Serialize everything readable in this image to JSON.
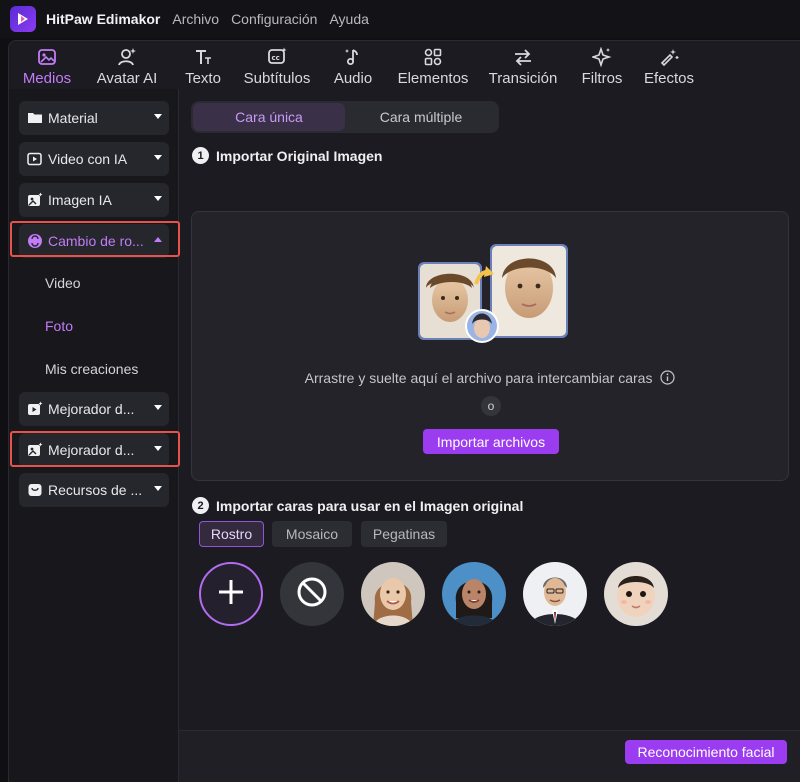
{
  "app": {
    "name": "HitPaw Edimakor"
  },
  "menu": [
    "Archivo",
    "Configuración",
    "Ayuda"
  ],
  "toolbar": [
    {
      "label": "Medios",
      "icon": "media-icon",
      "active": true
    },
    {
      "label": "Avatar AI",
      "icon": "avatar-icon"
    },
    {
      "label": "Texto",
      "icon": "text-icon"
    },
    {
      "label": "Subtítulos",
      "icon": "subtitles-icon"
    },
    {
      "label": "Audio",
      "icon": "music-note-icon"
    },
    {
      "label": "Elementos",
      "icon": "elements-icon"
    },
    {
      "label": "Transición",
      "icon": "transition-icon"
    },
    {
      "label": "Filtros",
      "icon": "sparkle-icon"
    },
    {
      "label": "Efectos",
      "icon": "effects-icon"
    }
  ],
  "sidebar": {
    "items": [
      {
        "label": "Material",
        "icon": "folder-icon"
      },
      {
        "label": "Video con IA",
        "icon": "ai-video-icon"
      },
      {
        "label": "Imagen IA",
        "icon": "ai-image-icon"
      },
      {
        "label": "Cambio de ro...",
        "icon": "face-swap-icon",
        "expanded": true
      },
      {
        "label": "Mejorador d...",
        "icon": "video-enhancer-icon"
      },
      {
        "label": "Mejorador d...",
        "icon": "image-enhancer-icon"
      },
      {
        "label": "Recursos de ...",
        "icon": "resources-icon"
      }
    ],
    "sub_items": [
      {
        "label": "Video"
      },
      {
        "label": "Foto",
        "active": true
      },
      {
        "label": "Mis creaciones"
      }
    ]
  },
  "content": {
    "tabs": [
      {
        "label": "Cara única",
        "active": true
      },
      {
        "label": "Cara múltiple"
      }
    ],
    "step1": {
      "num": "1",
      "title": "Importar Original Imagen"
    },
    "dropzone": {
      "text": "Arrastre y suelte aquí el archivo para intercambiar caras",
      "or": "o",
      "button": "Importar archivos"
    },
    "step2": {
      "num": "2",
      "title": "Importar caras para usar en el Imagen original"
    },
    "chips": [
      {
        "label": "Rostro",
        "active": true
      },
      {
        "label": "Mosaico"
      },
      {
        "label": "Pegatinas"
      }
    ],
    "recognize_button": "Reconocimiento facial"
  },
  "colors": {
    "accent": "#9b3cf0",
    "accent_text": "#c27cf7",
    "highlight": "#e5534b",
    "bg": "#1b1b21"
  }
}
